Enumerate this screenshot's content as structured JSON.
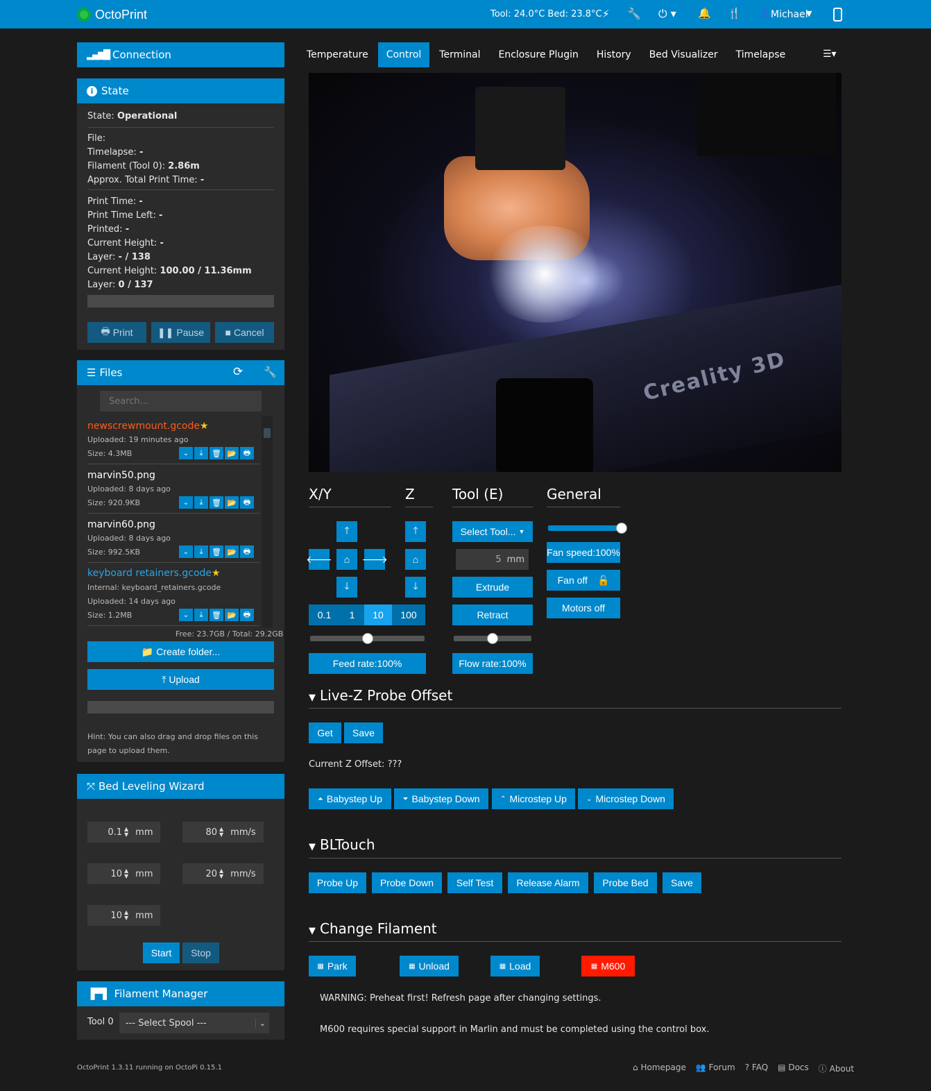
{
  "navbar": {
    "brand": "OctoPrint",
    "temps": "Tool: 24.0°C Bed: 23.8°C",
    "user": "Michael"
  },
  "connection": {
    "title": "Connection"
  },
  "state": {
    "title": "State",
    "state_label": "State:",
    "state_value": "Operational",
    "rows1": [
      {
        "label": "File:",
        "value": ""
      },
      {
        "label": "Timelapse:",
        "value": "-"
      },
      {
        "label": "Filament (Tool 0):",
        "value": "2.86m"
      },
      {
        "label": "Approx. Total Print Time:",
        "value": "-"
      }
    ],
    "rows2": [
      {
        "label": "Print Time:",
        "value": "-"
      },
      {
        "label": "Print Time Left:",
        "value": "-"
      },
      {
        "label": "Printed:",
        "value": "-"
      },
      {
        "label": "Current Height:",
        "value": "-"
      },
      {
        "label": "Layer:",
        "value": "- / 138"
      },
      {
        "label": "Current Height:",
        "value": "100.00 / 11.36mm"
      },
      {
        "label": "Layer:",
        "value": "0 / 137"
      }
    ],
    "print": "Print",
    "pause": "Pause",
    "cancel": "Cancel"
  },
  "files": {
    "title": "Files",
    "search_placeholder": "Search...",
    "items": [
      {
        "name": "newscrewmount.gcode",
        "line1": "Uploaded: 19 minutes ago",
        "line2": "Size: 4.3MB",
        "line3": ""
      },
      {
        "name": "marvin50.png",
        "line1": "Uploaded: 8 days ago",
        "line2": "Size: 920.9KB",
        "line3": ""
      },
      {
        "name": "marvin60.png",
        "line1": "Uploaded: 8 days ago",
        "line2": "Size: 992.5KB",
        "line3": ""
      },
      {
        "name": "keyboard retainers.gcode",
        "line1": "Internal: keyboard_retainers.gcode",
        "line2": "Uploaded: 14 days ago",
        "line3": "Size: 1.2MB"
      }
    ],
    "storage": "Free: 23.7GB / Total: 29.2GB",
    "create_folder": "Create folder...",
    "upload": "Upload",
    "hint": "Hint: You can also drag and drop files on this page to upload them."
  },
  "bed_leveling": {
    "title": "Bed Leveling Wizard",
    "f1": "0.1",
    "u1": "mm",
    "f2": "80",
    "u2": "mm/s",
    "f3": "10",
    "u3": "mm",
    "f4": "20",
    "u4": "mm/s",
    "f5": "10",
    "u5": "mm",
    "start": "Start",
    "stop": "Stop"
  },
  "filament_manager": {
    "title": "Filament Manager",
    "tool": "Tool 0",
    "spool": "--- Select Spool ---"
  },
  "tabs": [
    "Temperature",
    "Control",
    "Terminal",
    "Enclosure Plugin",
    "History",
    "Bed Visualizer",
    "Timelapse"
  ],
  "control": {
    "xy": "X/Y",
    "z": "Z",
    "tool": "Tool (E)",
    "general": "General",
    "steps": [
      "0.1",
      "1",
      "10",
      "100"
    ],
    "select_tool": "Select Tool...",
    "extrude_amount": "5",
    "extrude_unit": "mm",
    "extrude": "Extrude",
    "retract": "Retract",
    "feed_rate": "Feed rate:100%",
    "flow_rate": "Flow rate:100%",
    "fan_speed": "Fan speed:100%",
    "fan_off": "Fan off",
    "motors_off": "Motors off",
    "feed_level": 0.5,
    "flow_level": 0.5,
    "fan_level": 1.0
  },
  "livez": {
    "title": "Live-Z Probe Offset",
    "get": "Get",
    "save": "Save",
    "offset": "Current Z Offset: ???",
    "babystep_up": "Babystep Up",
    "babystep_down": "Babystep Down",
    "microstep_up": "Microstep Up",
    "microstep_down": "Microstep Down"
  },
  "bltouch": {
    "title": "BLTouch",
    "buttons": [
      "Probe Up",
      "Probe Down",
      "Self Test",
      "Release Alarm",
      "Probe Bed",
      "Save"
    ]
  },
  "change_filament": {
    "title": "Change Filament",
    "park": "Park",
    "unload": "Unload",
    "load": "Load",
    "m600": "M600",
    "warning": "WARNING: Preheat first! Refresh page after changing settings.",
    "note": "M600 requires special support in Marlin and must be completed using the control box."
  },
  "footer": {
    "version": "OctoPrint 1.3.11 running on OctoPi 0.15.1",
    "homepage": "Homepage",
    "forum": "Forum",
    "faq": "FAQ",
    "docs": "Docs",
    "about": "About"
  }
}
